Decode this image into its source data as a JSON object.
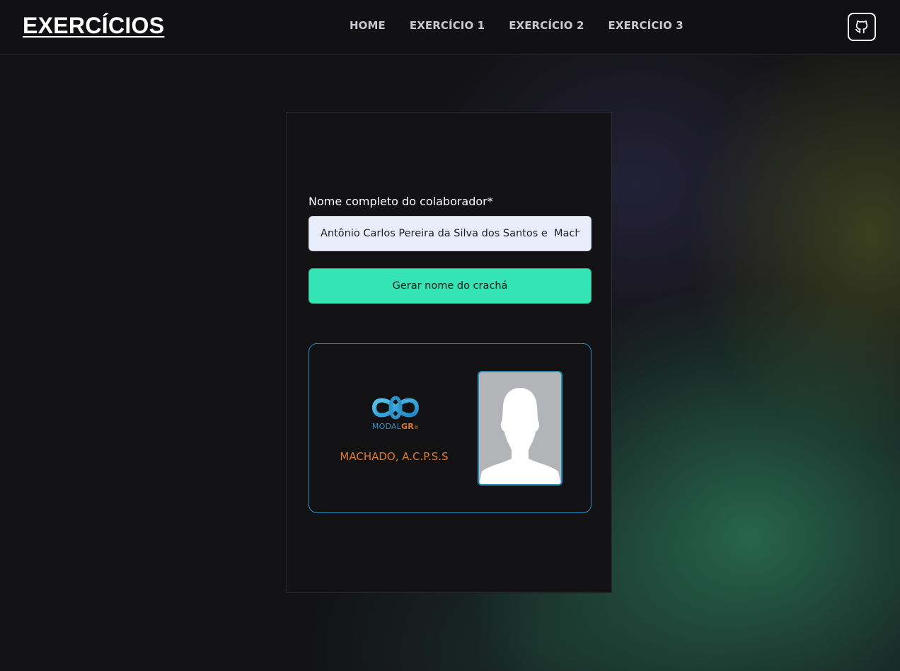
{
  "header": {
    "brand": "EXERCÍCIOS",
    "nav": [
      "HOME",
      "EXERCÍCIO 1",
      "EXERCÍCIO 2",
      "EXERCÍCIO 3"
    ],
    "github_icon": "github-icon"
  },
  "form": {
    "label": "Nome completo do colaborador*",
    "input_value": "Antônio Carlos Pereira da Silva dos Santos e  Machado",
    "button_label": "Gerar nome do crachá"
  },
  "badge": {
    "logo_text_modal": "MODAL",
    "logo_text_gr": "GR",
    "logo_mark": "®",
    "name": "MACHADO, A.C.P.S.S",
    "photo_icon": "person-silhouette-icon"
  },
  "colors": {
    "accent_button": "#34e4b4",
    "badge_border": "#1f8fbf",
    "badge_name": "#e07a2c",
    "background": "#131316"
  }
}
